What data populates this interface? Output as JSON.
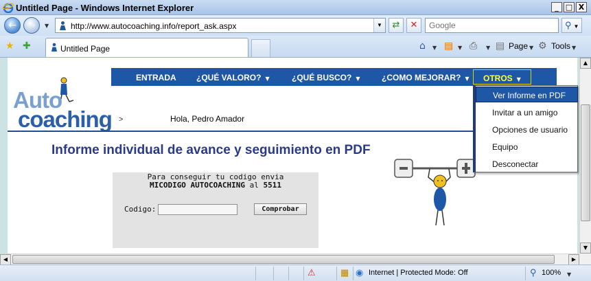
{
  "window": {
    "title": "Untitled Page - Windows Internet Explorer",
    "minimize": "_",
    "maximize": "□",
    "close": "X"
  },
  "address_bar": {
    "url": "http://www.autocoaching.info/report_ask.aspx",
    "search_placeholder": "Google"
  },
  "tab": {
    "label": "Untitled Page"
  },
  "command_bar": {
    "page_label": "Page",
    "tools_label": "Tools"
  },
  "site": {
    "logo": {
      "line1": "Auto",
      "line2": "coaching"
    },
    "menu": [
      {
        "label": "ENTRADA",
        "has_arrow": false
      },
      {
        "label": "¿QUÉ VALORO?",
        "has_arrow": true
      },
      {
        "label": "¿QUÉ BUSCO?",
        "has_arrow": true
      },
      {
        "label": "¿COMO MEJORAR?",
        "has_arrow": true
      },
      {
        "label": "OTROS",
        "has_arrow": true,
        "active": true
      }
    ],
    "submenu": [
      {
        "label": "Ver Informe en PDF",
        "highlighted": true
      },
      {
        "label": "Invitar a un amigo"
      },
      {
        "label": "Opciones de usuario"
      },
      {
        "label": "Equipo"
      },
      {
        "label": "Desconectar"
      }
    ],
    "breadcrumb_sep": ">",
    "greeting": "Hola, Pedro Amador",
    "page_title": "Informe individual de avance y seguimiento en PDF",
    "code_box": {
      "line1": "Para conseguir tu codigo envia",
      "keyword": "MICODIGO AUTOCOACHING",
      "connector": "al",
      "number": "5511",
      "label": "Codigo:",
      "input_value": "",
      "submit_label": "Comprobar"
    }
  },
  "status_bar": {
    "zone": "Internet | Protected Mode: Off",
    "zoom": "100%"
  },
  "colors": {
    "menu_bg": "#1e57a5",
    "menu_active_text": "#ffff40",
    "title_text": "#2a3a8a",
    "page_bg": "#cde3e3"
  }
}
